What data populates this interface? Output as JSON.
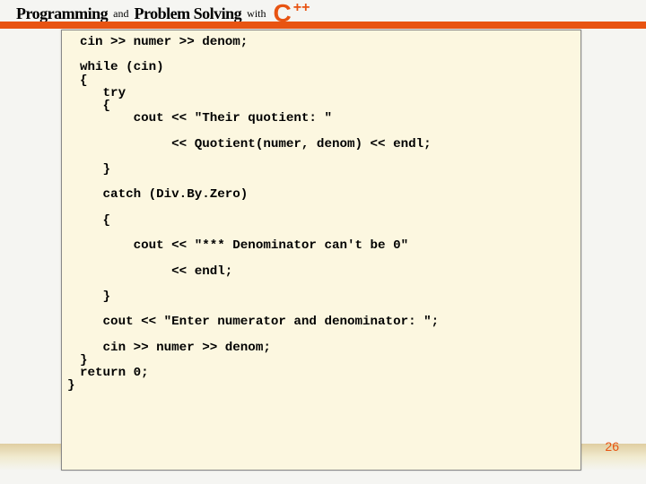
{
  "header": {
    "word1": "Programming",
    "conj": "and",
    "word2": "Problem Solving",
    "word3": "with",
    "lang_c": "C",
    "lang_pp": "++"
  },
  "code": {
    "l01": "cin >> numer >> denom;",
    "l02": "",
    "l03": "while (cin)",
    "l04": "{",
    "l05": "   try",
    "l06": "   {",
    "l07": "       cout << \"Their quotient: \"",
    "l08": "",
    "l09": "            << Quotient(numer, denom) << endl;",
    "l10": "",
    "l11": "   }",
    "l12": "",
    "l13": "   catch (Div.By.Zero)",
    "l14": "",
    "l15": "   {",
    "l16": "",
    "l17": "       cout << \"*** Denominator can't be 0\"",
    "l18": "",
    "l19": "            << endl;",
    "l20": "",
    "l21": "   }",
    "l22": "",
    "l23": "   cout << \"Enter numerator and denominator: \";",
    "l24": "",
    "l25": "   cin >> numer >> denom;",
    "l26": "}",
    "l27": "return 0;",
    "l28_close": "}"
  },
  "footer": {
    "page": "26"
  }
}
